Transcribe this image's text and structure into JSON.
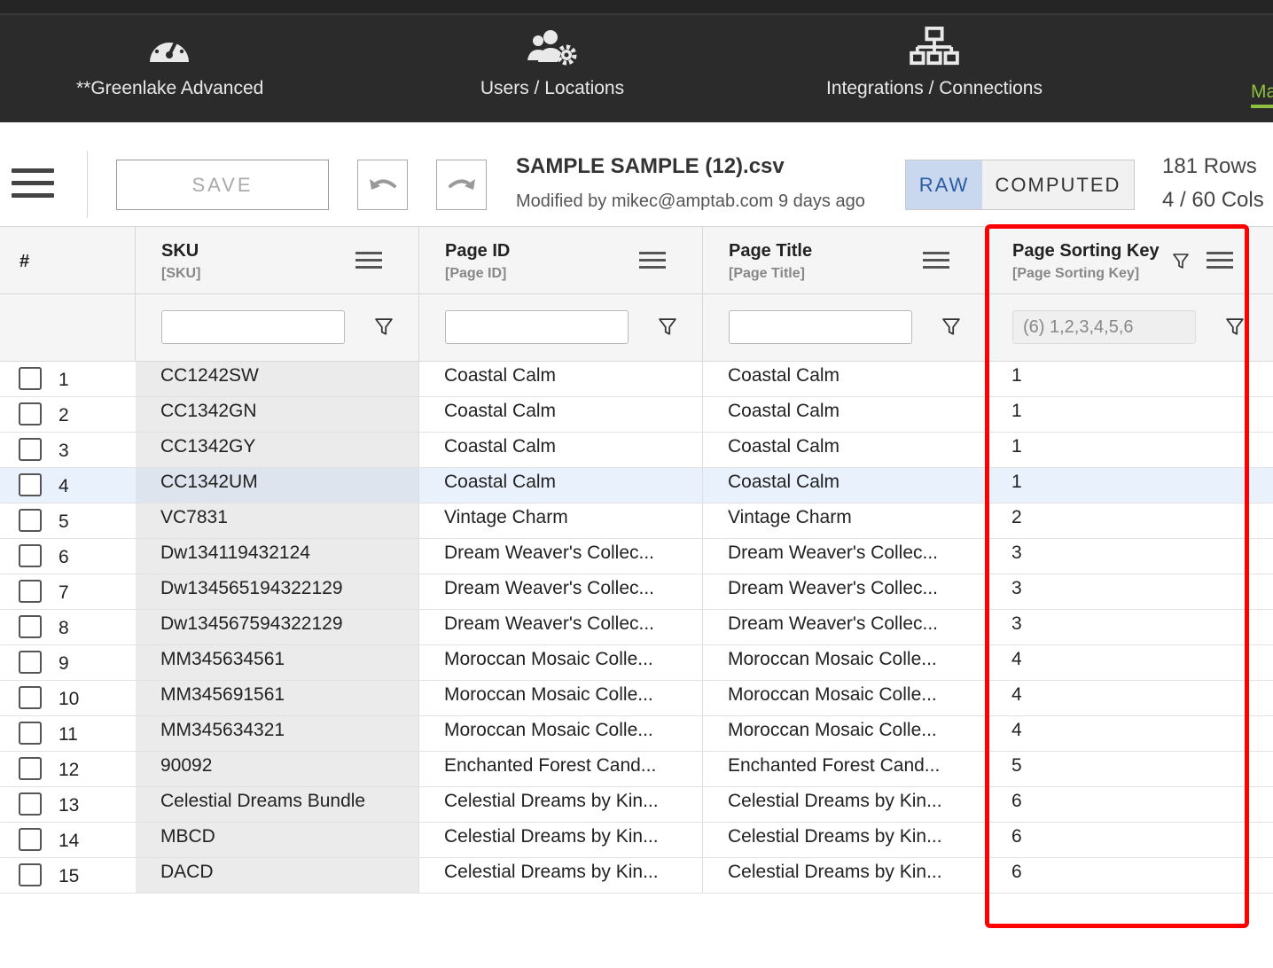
{
  "nav": {
    "items": [
      {
        "label": "**Greenlake Advanced",
        "icon": "dashboard-gauge-icon"
      },
      {
        "label": "Users / Locations",
        "icon": "users-gear-icon"
      },
      {
        "label": "Integrations / Connections",
        "icon": "network-icon"
      }
    ],
    "cut_item": "Ma",
    "accent": "#8fbf3f"
  },
  "toolbar": {
    "save_label": "SAVE",
    "file_title": "SAMPLE SAMPLE (12).csv",
    "modified": "Modified by mikec@amptab.com 9 days ago",
    "mode_raw": "RAW",
    "mode_computed": "COMPUTED",
    "rows": "181 Rows",
    "cols": "4 / 60 Cols"
  },
  "grid": {
    "row_number_header": "#",
    "columns": [
      {
        "title": "SKU",
        "sub": "[SKU]",
        "filter_value": ""
      },
      {
        "title": "Page ID",
        "sub": "[Page ID]",
        "filter_value": ""
      },
      {
        "title": "Page Title",
        "sub": "[Page Title]",
        "filter_value": ""
      },
      {
        "title": "Page Sorting Key",
        "sub": "[Page Sorting Key]",
        "filter_value": "(6) 1,2,3,4,5,6"
      }
    ],
    "rows": [
      {
        "n": "1",
        "sku": "CC1242SW",
        "page_id": "Coastal Calm",
        "page_title": "Coastal Calm",
        "key": "1"
      },
      {
        "n": "2",
        "sku": "CC1342GN",
        "page_id": "Coastal Calm",
        "page_title": "Coastal Calm",
        "key": "1"
      },
      {
        "n": "3",
        "sku": "CC1342GY",
        "page_id": "Coastal Calm",
        "page_title": "Coastal Calm",
        "key": "1"
      },
      {
        "n": "4",
        "sku": "CC1342UM",
        "page_id": "Coastal Calm",
        "page_title": "Coastal Calm",
        "key": "1"
      },
      {
        "n": "5",
        "sku": "VC7831",
        "page_id": "Vintage Charm",
        "page_title": "Vintage Charm",
        "key": "2"
      },
      {
        "n": "6",
        "sku": "Dw134119432124",
        "page_id": "Dream Weaver's Collec...",
        "page_title": "Dream Weaver's Collec...",
        "key": "3"
      },
      {
        "n": "7",
        "sku": "Dw134565194322129",
        "page_id": "Dream Weaver's Collec...",
        "page_title": "Dream Weaver's Collec...",
        "key": "3"
      },
      {
        "n": "8",
        "sku": "Dw134567594322129",
        "page_id": "Dream Weaver's Collec...",
        "page_title": "Dream Weaver's Collec...",
        "key": "3"
      },
      {
        "n": "9",
        "sku": "MM345634561",
        "page_id": "Moroccan Mosaic Colle...",
        "page_title": "Moroccan Mosaic Colle...",
        "key": "4"
      },
      {
        "n": "10",
        "sku": "MM345691561",
        "page_id": "Moroccan Mosaic Colle...",
        "page_title": "Moroccan Mosaic Colle...",
        "key": "4"
      },
      {
        "n": "11",
        "sku": "MM345634321",
        "page_id": "Moroccan Mosaic Colle...",
        "page_title": "Moroccan Mosaic Colle...",
        "key": "4"
      },
      {
        "n": "12",
        "sku": "90092",
        "page_id": "Enchanted Forest Cand...",
        "page_title": "Enchanted Forest Cand...",
        "key": "5"
      },
      {
        "n": "13",
        "sku": "Celestial Dreams Bundle",
        "page_id": "Celestial Dreams by Kin...",
        "page_title": "Celestial Dreams by Kin...",
        "key": "6"
      },
      {
        "n": "14",
        "sku": "MBCD",
        "page_id": "Celestial Dreams by Kin...",
        "page_title": "Celestial Dreams by Kin...",
        "key": "6"
      },
      {
        "n": "15",
        "sku": "DACD",
        "page_id": "Celestial Dreams by Kin...",
        "page_title": "Celestial Dreams by Kin...",
        "key": "6"
      }
    ],
    "selected_row": "4"
  },
  "colors": {
    "nav_bg": "#2b2b2b",
    "raw_active_bg": "#c9d8ee",
    "highlight_border": "#ff0000",
    "selected_row_bg": "#e9f1fc"
  }
}
